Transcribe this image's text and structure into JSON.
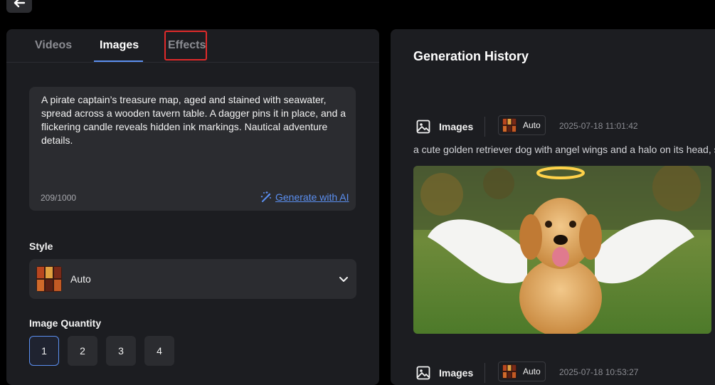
{
  "tabs": {
    "videos": "Videos",
    "images": "Images",
    "effects": "Effects"
  },
  "prompt": {
    "text": "A pirate captain’s treasure map, aged and stained with seawater, spread across a wooden tavern table. A dagger pins it in place, and a flickering candle reveals hidden ink markings. Nautical adventure details.",
    "counter": "209/1000",
    "generate_ai": "Generate with AI"
  },
  "style": {
    "label": "Style",
    "value": "Auto"
  },
  "quantity": {
    "label": "Image Quantity",
    "options": [
      "1",
      "2",
      "3",
      "4"
    ],
    "selected": 1
  },
  "history": {
    "title": "Generation History",
    "entries": [
      {
        "type": "Images",
        "style": "Auto",
        "timestamp": "2025-07-18 11:01:42",
        "prompt": "a cute golden retriever dog with angel wings and a halo on its head, s"
      },
      {
        "type": "Images",
        "style": "Auto",
        "timestamp": "2025-07-18 10:53:27"
      }
    ]
  },
  "colors": {
    "accent": "#5b8ff0",
    "highlight_box": "#e02a2a",
    "panel": "#1c1d21",
    "field": "#2b2c30"
  }
}
